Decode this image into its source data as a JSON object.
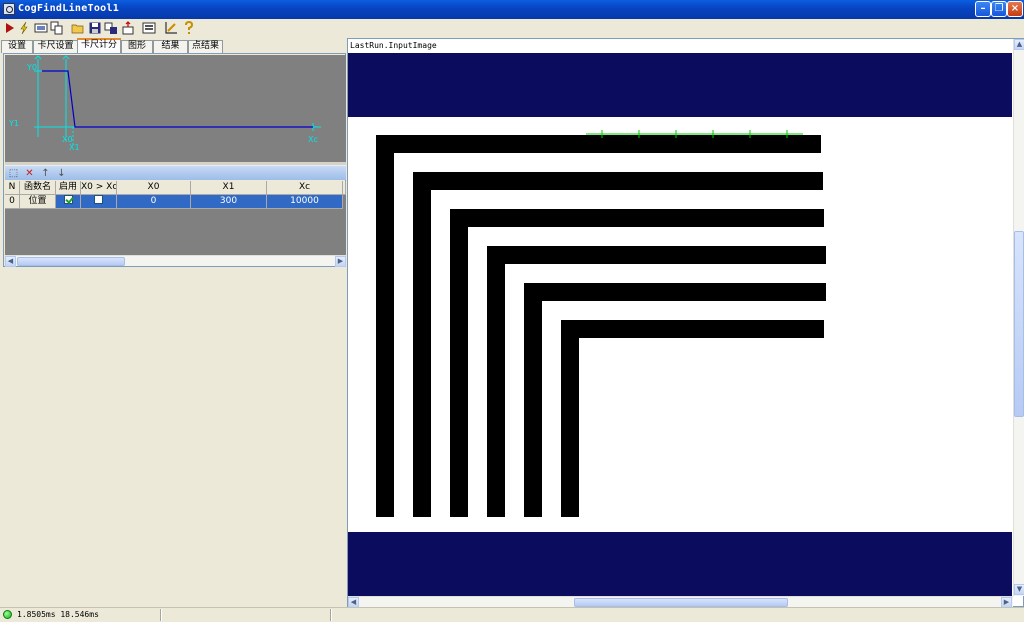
{
  "window": {
    "title": "CogFindLineTool1"
  },
  "colors": {
    "navy": "#0c0c5e",
    "selection": "#316ac5",
    "plot_line": "#0000cc",
    "plot_axis": "#00e6e6",
    "caliper": "#00cc00"
  },
  "toolbar": {
    "icons": [
      "run-icon",
      "electric-run-icon",
      "image-source-icon",
      "copy-icon",
      "open-icon",
      "save-icon",
      "reset-icon",
      "export-icon",
      "display-icon",
      "ruler-icon",
      "help-icon"
    ]
  },
  "tabs": [
    "设置",
    "卡尺设置",
    "卡尺计分",
    "图形",
    "结果",
    "点结果"
  ],
  "active_tab": "卡尺计分",
  "scoring_plot": {
    "y0": "Y0",
    "y1": "Y1",
    "x0": "X0",
    "x1": "X1",
    "xc": "Xc"
  },
  "grid": {
    "headers": [
      "N",
      "函数名",
      "启用",
      "X0 > Xc",
      "X0",
      "X1",
      "Xc"
    ],
    "rows": [
      {
        "n": "0",
        "name": "位置",
        "enabled": true,
        "x0_gt_xc": false,
        "x0": "0",
        "x1": "300",
        "xc": "10000"
      }
    ]
  },
  "display": {
    "title": "LastRun.InputImage"
  },
  "status": {
    "text": "1.8505ms  18.546ms"
  }
}
